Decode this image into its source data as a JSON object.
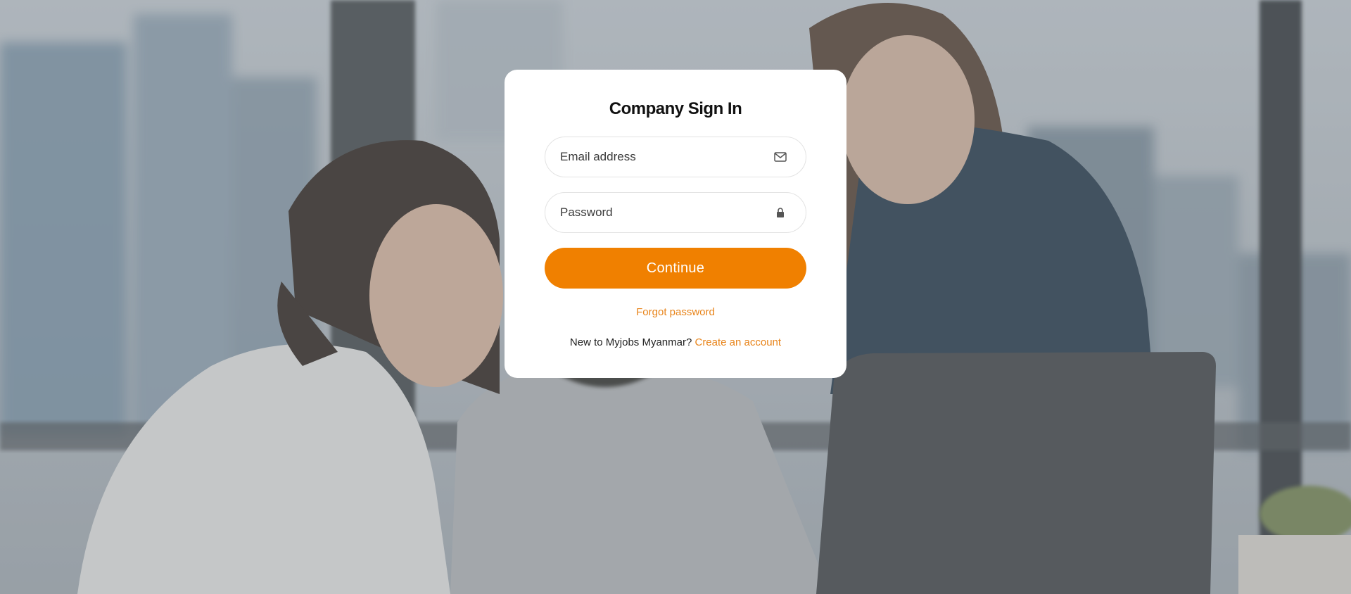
{
  "page": {
    "title": "Company Sign In"
  },
  "form": {
    "email": {
      "value": "",
      "placeholder": "Email address",
      "icon": "envelope-icon"
    },
    "password": {
      "value": "",
      "placeholder": "Password",
      "icon": "lock-icon"
    },
    "continue_label": "Continue",
    "forgot_label": "Forgot password",
    "signup_prompt": "New to Myjobs Myanmar?",
    "signup_link": "Create an account"
  },
  "colors": {
    "accent": "#f08000",
    "link": "#e8841a",
    "card": "#ffffff"
  }
}
